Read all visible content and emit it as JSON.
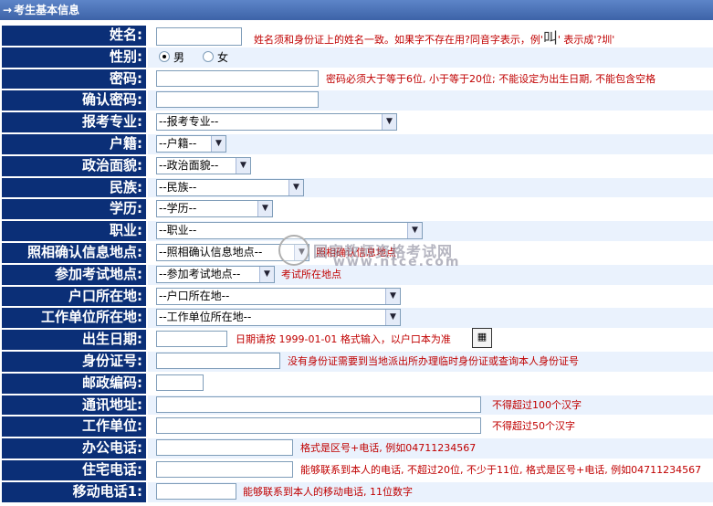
{
  "header": {
    "arrow": "→",
    "title": "考生基本信息"
  },
  "form": {
    "name": {
      "label": "姓名:",
      "hint": "姓名须和身份证上的姓名一致。如果字不存在用?同音字表示，例'",
      "hint_char": "叫",
      "hint_tail": "' 表示成'?圳'"
    },
    "gender": {
      "label": "性别:",
      "male": "男",
      "female": "女"
    },
    "password": {
      "label": "密码:",
      "hint": "密码必须大于等于6位, 小于等于20位; 不能设定为出生日期, 不能包含空格"
    },
    "confirm_password": {
      "label": "确认密码:"
    },
    "major": {
      "label": "报考专业:",
      "value": "--报考专业--"
    },
    "household": {
      "label": "户籍:",
      "value": "--户籍--"
    },
    "political": {
      "label": "政治面貌:",
      "value": "--政治面貌--"
    },
    "ethnic": {
      "label": "民族:",
      "value": "--民族--"
    },
    "education": {
      "label": "学历:",
      "value": "--学历--"
    },
    "occupation": {
      "label": "职业:",
      "value": "--职业--"
    },
    "photo_site": {
      "label": "照相确认信息地点:",
      "value": "--照相确认信息地点--",
      "hint": "照相确认信息地点"
    },
    "exam_site": {
      "label": "参加考试地点:",
      "value": "--参加考试地点--",
      "hint": "考试所在地点"
    },
    "hukou": {
      "label": "户口所在地:",
      "value": "--户口所在地--"
    },
    "workplace_loc": {
      "label": "工作单位所在地:",
      "value": "--工作单位所在地--"
    },
    "birth": {
      "label": "出生日期:",
      "hint": "日期请按 1999-01-01 格式输入，以户口本为准",
      "cal_icon": "calendar-icon"
    },
    "id_number": {
      "label": "身份证号:",
      "hint": "没有身份证需要到当地派出所办理临时身份证或查询本人身份证号"
    },
    "postcode": {
      "label": "邮政编码:"
    },
    "address": {
      "label": "通讯地址:",
      "hint": "不得超过100个汉字"
    },
    "employer": {
      "label": "工作单位:",
      "hint": "不得超过50个汉字"
    },
    "office_phone": {
      "label": "办公电话:",
      "hint": "格式是区号+电话, 例如04711234567"
    },
    "home_phone": {
      "label": "住宅电话:",
      "hint": "能够联系到本人的电话, 不超过20位, 不少于11位, 格式是区号+电话, 例如04711234567"
    },
    "mobile": {
      "label": "移动电话1:",
      "hint": "能够联系到本人的移动电话, 11位数字"
    }
  },
  "watermark": {
    "line1": "国家教师资格考试网",
    "line2": "www.ntce.com"
  }
}
